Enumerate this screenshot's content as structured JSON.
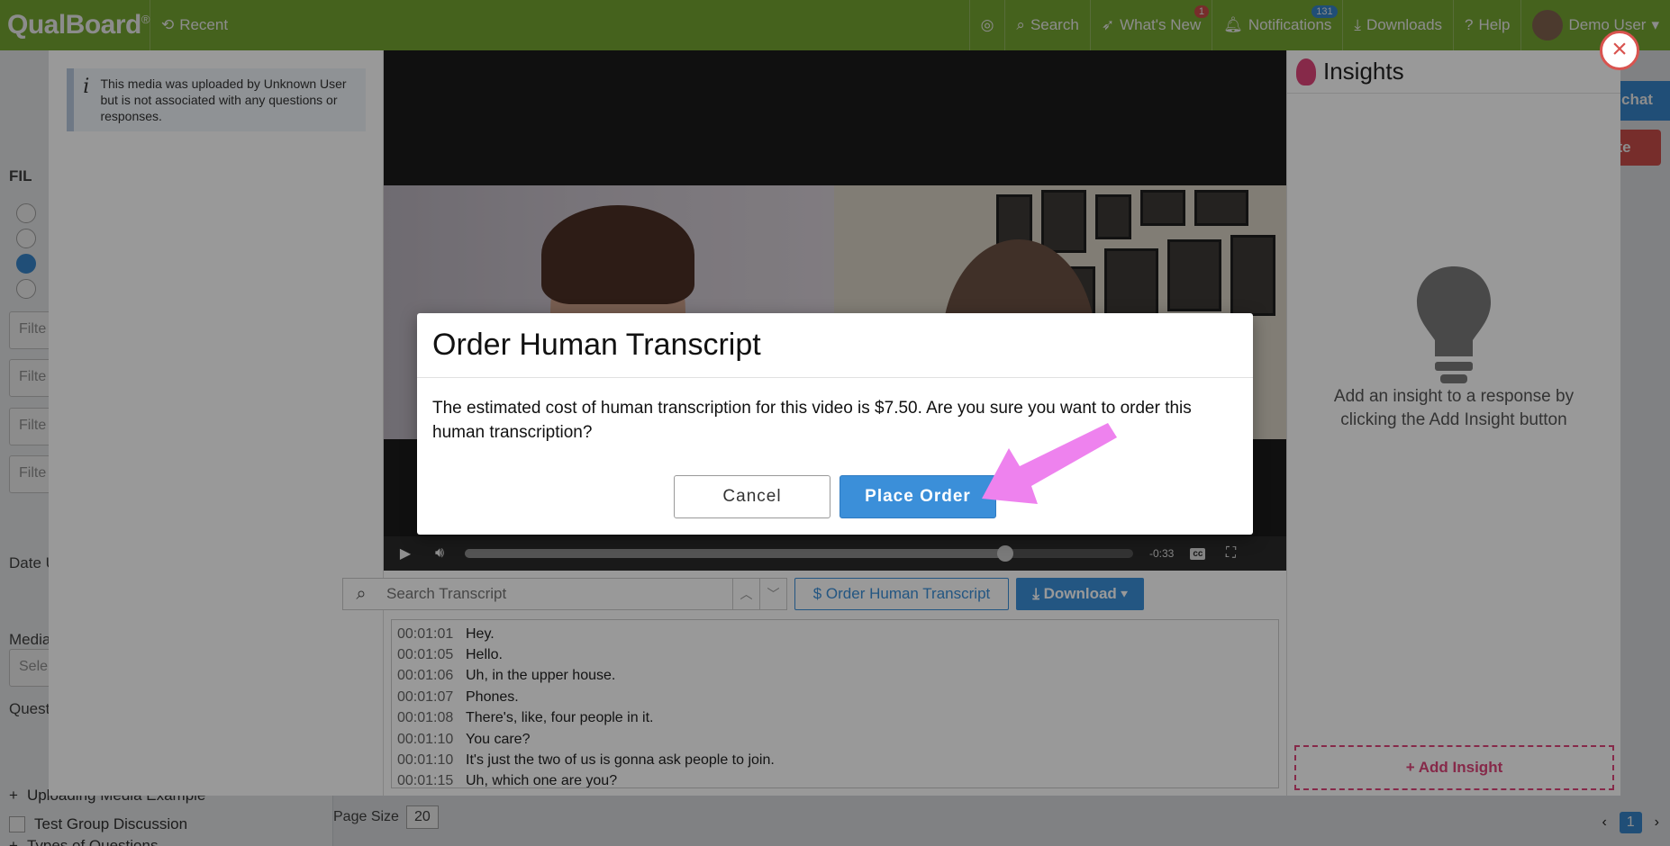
{
  "app": {
    "logo": "QualBoard",
    "logo_mark": "®",
    "nav_recent": "Recent",
    "nav_search": "Search",
    "nav_whats_new": "What's New",
    "whats_new_badge": "1",
    "nav_notifications": "Notifications",
    "notifications_badge": "131",
    "nav_downloads": "Downloads",
    "nav_help": "Help",
    "user_name": "Demo User",
    "accent_color": "#7fb236"
  },
  "background": {
    "chat_label": "chat",
    "delete_label": "ete",
    "filter_label": "FIL",
    "filter_placeholder": "Filte",
    "date_label": "Date U",
    "media_label": "Media",
    "media_select": "Sele",
    "questions_label": "Quest",
    "tree_item_1": "Uploading Media Example",
    "tree_item_2": "Test Group Discussion",
    "tree_item_3": "Types of Questions",
    "page_size_label": "Page Size",
    "page_size_value": "20",
    "current_page": "1"
  },
  "media_viewer": {
    "notice": "This media was uploaded by Unknown User but is not associated with any questions or responses.",
    "time_remaining": "-0:33",
    "progress_fraction": 0.808,
    "cc_label": "cc",
    "search_placeholder": "Search Transcript",
    "order_transcript_label": "$ Order Human Transcript",
    "download_label": "Download",
    "transcript": [
      {
        "time": "00:01:01",
        "text": "Hey."
      },
      {
        "time": "00:01:05",
        "text": "Hello."
      },
      {
        "time": "00:01:06",
        "text": "Uh, in the upper house."
      },
      {
        "time": "00:01:07",
        "text": "Phones."
      },
      {
        "time": "00:01:08",
        "text": "There's, like, four people in it."
      },
      {
        "time": "00:01:10",
        "text": "You care?"
      },
      {
        "time": "00:01:10",
        "text": "It's just the two of us is gonna ask people to join."
      },
      {
        "time": "00:01:15",
        "text": "Uh, which one are you?"
      }
    ]
  },
  "insights": {
    "title": "Insights",
    "empty_text": "Add an insight to a response by clicking the Add Insight button",
    "add_button": "+ Add Insight",
    "accent_color": "#e0457b"
  },
  "dialog": {
    "title": "Order Human Transcript",
    "body": "The estimated cost of human transcription for this video is $7.50. Are you sure you want to order this human transcription?",
    "cancel_label": "Cancel",
    "confirm_label": "Place Order",
    "primary_color": "#3b8fd9"
  },
  "annotation": {
    "arrow_color": "#ee82ee"
  }
}
